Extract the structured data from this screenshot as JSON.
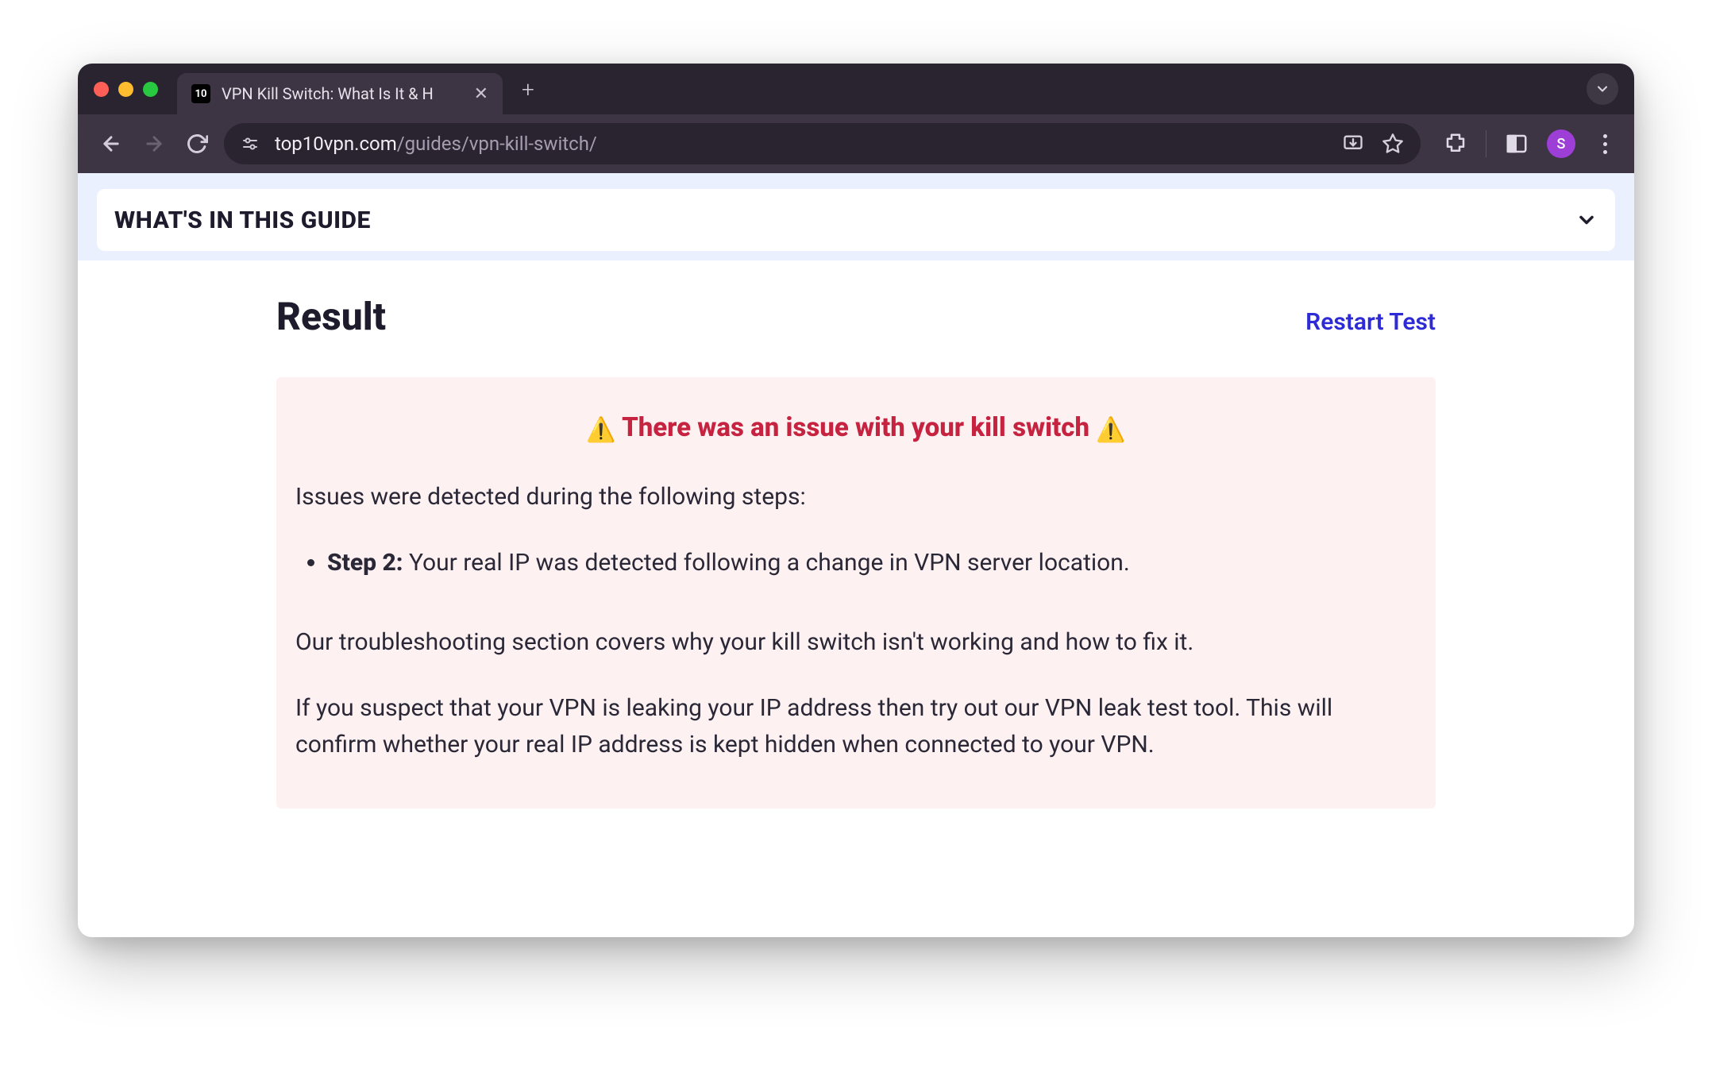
{
  "browser": {
    "tab": {
      "favicon_text": "10",
      "title": "VPN Kill Switch: What Is It & H"
    },
    "url": {
      "domain": "top10vpn.com",
      "path": "/guides/vpn-kill-switch/"
    },
    "profile_initial": "S"
  },
  "guide_bar": {
    "title": "WHAT'S IN THIS GUIDE"
  },
  "result": {
    "heading": "Result",
    "restart_label": "Restart Test",
    "issue_headline": "There was an issue with your kill switch",
    "warning_emoji": "⚠️",
    "intro_text": "Issues were detected during the following steps:",
    "step": {
      "label": "Step 2:",
      "text": " Your real IP was detected following a change in VPN server location."
    },
    "troubleshooting_text": "Our troubleshooting section covers why your kill switch isn't working and how to fix it.",
    "leak_text": "If you suspect that your VPN is leaking your IP address then try out our VPN leak test tool. This will confirm whether your real IP address is kept hidden when connected to your VPN."
  }
}
